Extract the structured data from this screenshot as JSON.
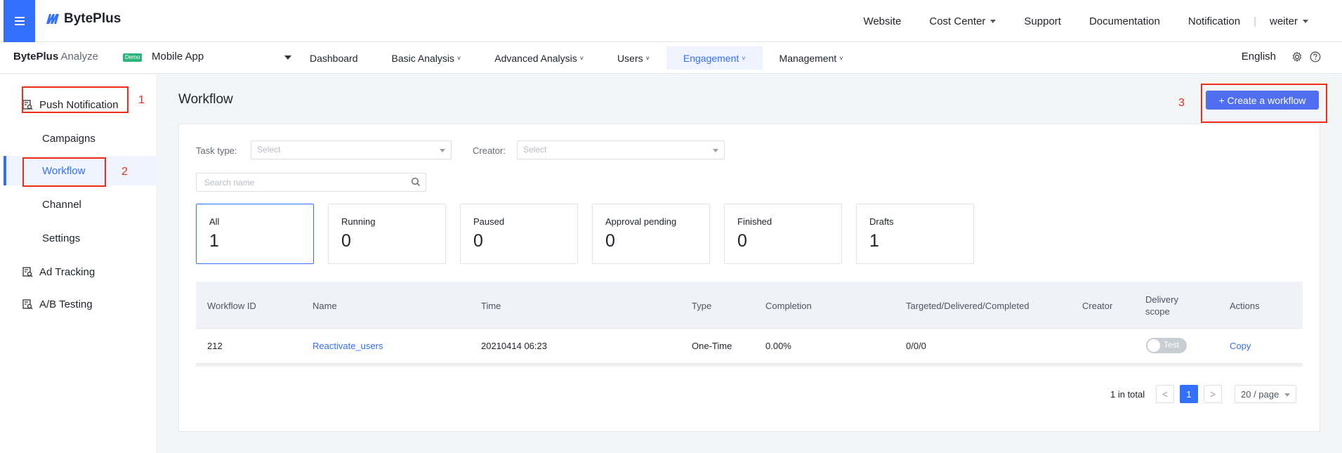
{
  "header": {
    "brand": "BytePlus",
    "nav": [
      {
        "label": "Website",
        "dropdown": false
      },
      {
        "label": "Cost Center",
        "dropdown": true
      },
      {
        "label": "Support",
        "dropdown": false
      },
      {
        "label": "Documentation",
        "dropdown": false
      },
      {
        "label": "Notification",
        "dropdown": false
      }
    ],
    "separator": "|",
    "user": "weiter"
  },
  "subheader": {
    "product_bold": "BytePlus",
    "product_light": "Analyze",
    "badge": "Demo",
    "app": "Mobile App",
    "nav": [
      "Dashboard",
      "Basic Analysis",
      "Advanced Analysis",
      "Users",
      "Engagement",
      "Management"
    ],
    "active_nav": "Engagement",
    "language": "English",
    "chevron": "˅"
  },
  "sidebar": {
    "sections": [
      "Push Notification",
      "Ad Tracking",
      "A/B Testing"
    ],
    "push_items": [
      "Campaigns",
      "Workflow",
      "Channel",
      "Settings"
    ],
    "active": "Workflow"
  },
  "annotations": [
    "1",
    "2",
    "3"
  ],
  "main": {
    "title": "Workflow",
    "create_button": "+ Create a workflow",
    "filters": {
      "task_type_label": "Task type:",
      "task_type_placeholder": "Select",
      "creator_label": "Creator:",
      "creator_placeholder": "Select",
      "search_placeholder": "Search name"
    },
    "status_cards": [
      {
        "label": "All",
        "count": "1"
      },
      {
        "label": "Running",
        "count": "0"
      },
      {
        "label": "Paused",
        "count": "0"
      },
      {
        "label": "Approval pending",
        "count": "0"
      },
      {
        "label": "Finished",
        "count": "0"
      },
      {
        "label": "Drafts",
        "count": "1"
      }
    ],
    "table": {
      "columns": [
        "Workflow ID",
        "Name",
        "Time",
        "Type",
        "Completion",
        "Targeted/Delivered/Completed",
        "Creator",
        "Delivery scope",
        "Actions"
      ],
      "rows": [
        {
          "id": "212",
          "name": "Reactivate_users",
          "time": "20210414 06:23",
          "type": "One-Time",
          "completion": "0.00%",
          "tdc": "0/0/0",
          "creator": "",
          "scope": "Test",
          "action": "Copy"
        }
      ]
    },
    "pagination": {
      "total": "1 in total",
      "prev": "<",
      "current": "1",
      "next": ">",
      "page_size": "20 / page"
    }
  },
  "colors": {
    "accent": "#3370ff",
    "button": "#4f6ef2",
    "annotation": "#ee2c18",
    "demo_badge": "#2db47d"
  }
}
